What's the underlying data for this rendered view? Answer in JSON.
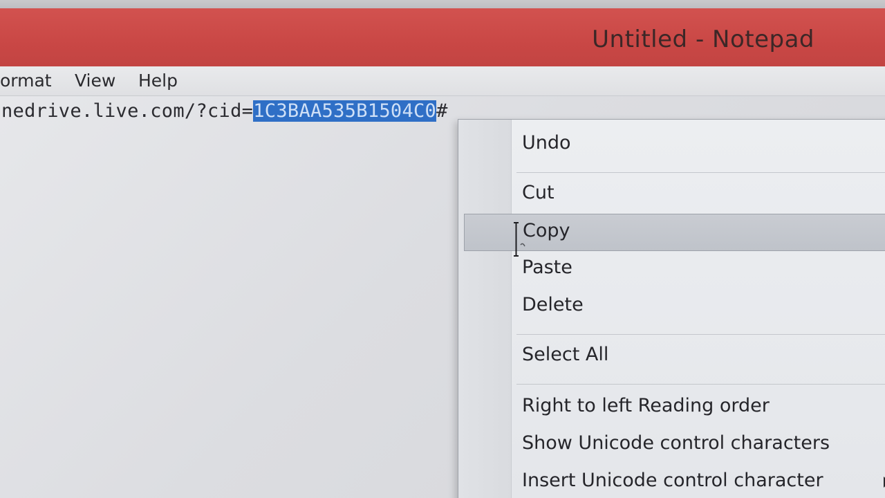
{
  "window": {
    "title": "Untitled - Notepad"
  },
  "menubar": {
    "items": [
      {
        "label": "ormat"
      },
      {
        "label": "View"
      },
      {
        "label": "Help"
      }
    ]
  },
  "editor": {
    "text_before": "nedrive.live.com/?cid=",
    "text_selected": "1C3BAA535B1504C0",
    "text_after": "#"
  },
  "context_menu": {
    "items": [
      {
        "label": "Undo"
      },
      {
        "label": "Cut"
      },
      {
        "label": "Copy"
      },
      {
        "label": "Paste"
      },
      {
        "label": "Delete"
      },
      {
        "label": "Select All"
      },
      {
        "label": "Right to left Reading order"
      },
      {
        "label": "Show Unicode control characters"
      },
      {
        "label": "Insert Unicode control character"
      }
    ]
  },
  "colors": {
    "titlebar": "#c94745",
    "selection": "#2f6fc6",
    "menu_highlight": "#c5c8ce"
  },
  "icons": {
    "pointer": "text-cursor-icon",
    "submenu": "chevron-right-icon"
  }
}
